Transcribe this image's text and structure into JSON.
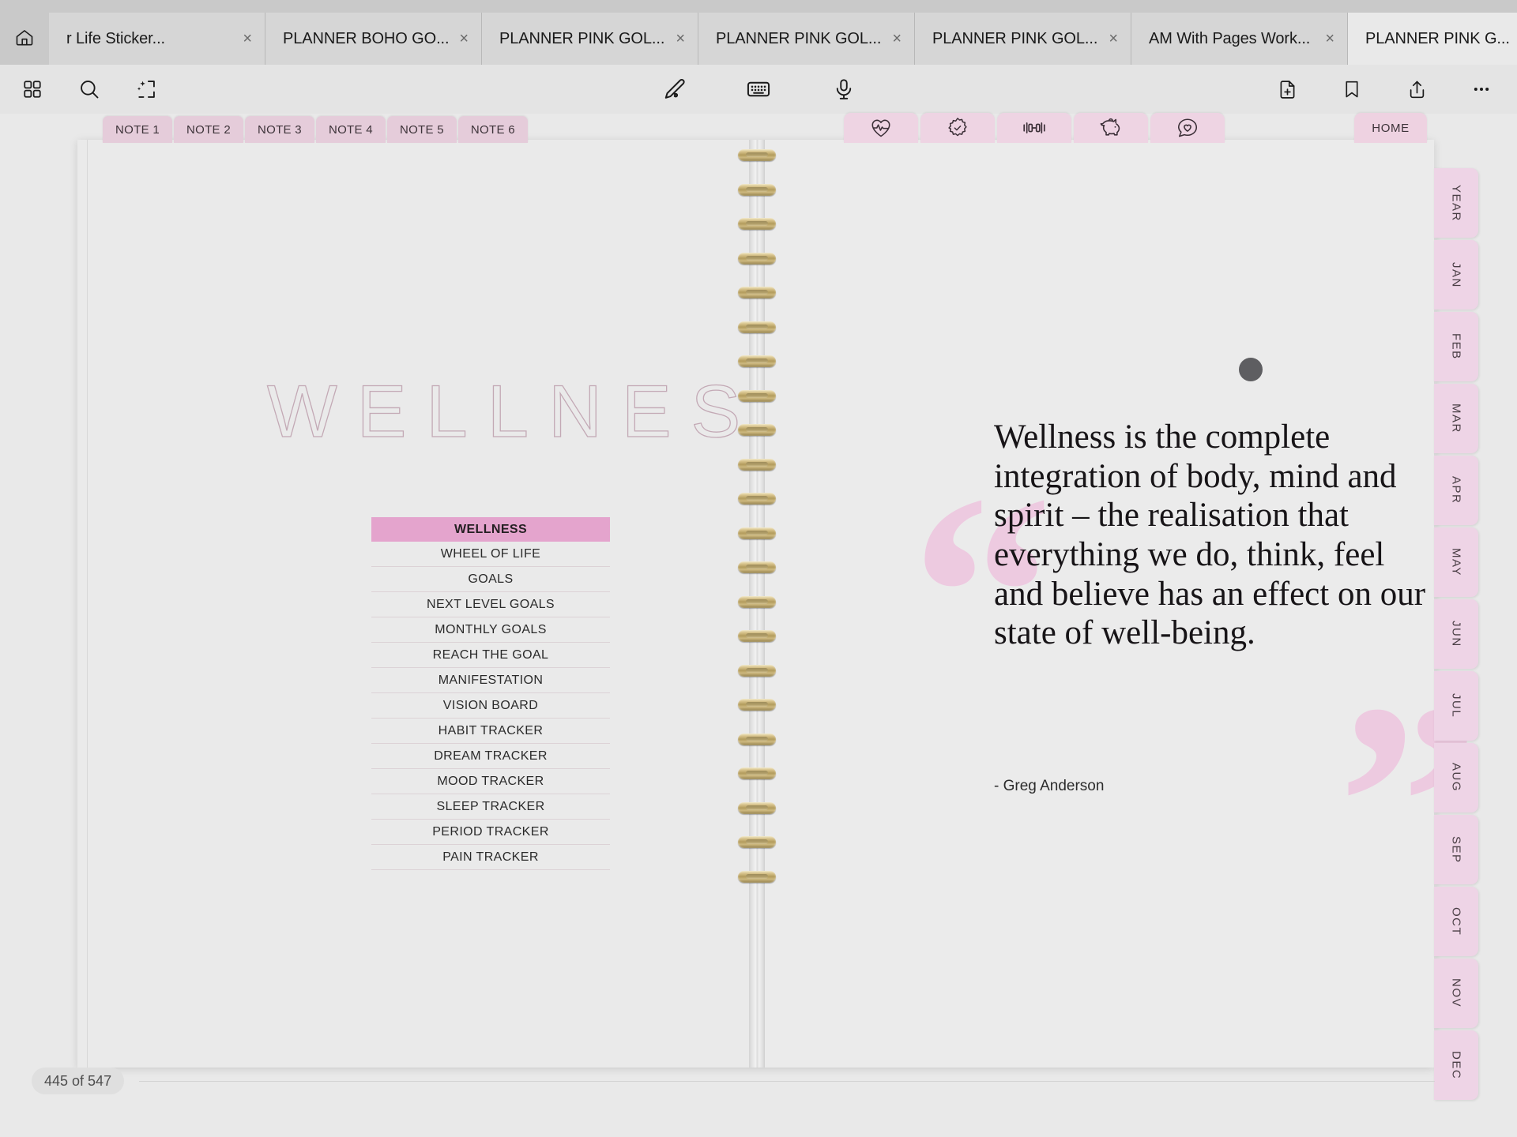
{
  "browser": {
    "home_icon": "home-icon",
    "tabs": [
      {
        "title": "r Life Sticker...",
        "close": "×",
        "active": false,
        "chevron": ""
      },
      {
        "title": "PLANNER BOHO GO...",
        "close": "×",
        "active": false,
        "chevron": ""
      },
      {
        "title": "PLANNER PINK GOL...",
        "close": "×",
        "active": false,
        "chevron": ""
      },
      {
        "title": "PLANNER PINK GOL...",
        "close": "×",
        "active": false,
        "chevron": ""
      },
      {
        "title": "PLANNER PINK GOL...",
        "close": "×",
        "active": false,
        "chevron": ""
      },
      {
        "title": "AM With Pages Work...",
        "close": "×",
        "active": false,
        "chevron": ""
      },
      {
        "title": "PLANNER PINK G...",
        "close": "×",
        "active": true,
        "chevron": "ˇ"
      }
    ]
  },
  "toolbar": {
    "left_icons": [
      "grid-icon",
      "search-icon",
      "ai-select-icon"
    ],
    "center_icons": [
      "pen-icon",
      "keyboard-icon",
      "microphone-icon"
    ],
    "right_icons": [
      "add-page-icon",
      "bookmark-icon",
      "share-icon",
      "more-icon"
    ]
  },
  "note_tabs": [
    {
      "label": "NOTE 1"
    },
    {
      "label": "NOTE 2"
    },
    {
      "label": "NOTE 3"
    },
    {
      "label": "NOTE 4"
    },
    {
      "label": "NOTE 5"
    },
    {
      "label": "NOTE 6"
    }
  ],
  "icon_tabs": [
    {
      "icon": "heart-pulse-icon"
    },
    {
      "icon": "sun-checklist-icon"
    },
    {
      "icon": "dumbbell-icon"
    },
    {
      "icon": "piggy-bank-icon"
    },
    {
      "icon": "heart-chat-icon"
    }
  ],
  "home_tab": {
    "label": "HOME"
  },
  "left_page": {
    "title": "WELLNESS",
    "menu": [
      {
        "label": "WELLNESS",
        "active": true
      },
      {
        "label": "WHEEL OF LIFE",
        "active": false
      },
      {
        "label": "GOALS",
        "active": false
      },
      {
        "label": "NEXT LEVEL GOALS",
        "active": false
      },
      {
        "label": "MONTHLY GOALS",
        "active": false
      },
      {
        "label": "REACH THE GOAL",
        "active": false
      },
      {
        "label": "MANIFESTATION",
        "active": false
      },
      {
        "label": "VISION BOARD",
        "active": false
      },
      {
        "label": "HABIT TRACKER",
        "active": false
      },
      {
        "label": "DREAM TRACKER",
        "active": false
      },
      {
        "label": "MOOD TRACKER",
        "active": false
      },
      {
        "label": "SLEEP TRACKER",
        "active": false
      },
      {
        "label": "PERIOD TRACKER",
        "active": false
      },
      {
        "label": "PAIN TRACKER",
        "active": false
      }
    ]
  },
  "right_page": {
    "quote_open_mark": "“",
    "quote_close_mark": "”",
    "quote_text": "Wellness is the complete integration of body, mind and spirit – the realisation that everything we do, think, feel and believe has an effect on our state of well-being.",
    "quote_author": "- Greg Anderson"
  },
  "side_tabs": [
    {
      "label": "YEAR"
    },
    {
      "label": "JAN"
    },
    {
      "label": "FEB"
    },
    {
      "label": "MAR"
    },
    {
      "label": "APR"
    },
    {
      "label": "MAY"
    },
    {
      "label": "JUN"
    },
    {
      "label": "JUL"
    },
    {
      "label": "AUG"
    },
    {
      "label": "SEP"
    },
    {
      "label": "OCT"
    },
    {
      "label": "NOV"
    },
    {
      "label": "DEC"
    }
  ],
  "status": {
    "page_indicator": "445 of 547"
  },
  "colors": {
    "tab_pink": "#eed4e6",
    "active_menu_pink": "#e4a4cd",
    "quote_mark_pink": "#eec8e0",
    "title_outline": "#c3a9b5",
    "page_bg": "#eaeaea",
    "chrome_bg": "#e4e4e4"
  }
}
